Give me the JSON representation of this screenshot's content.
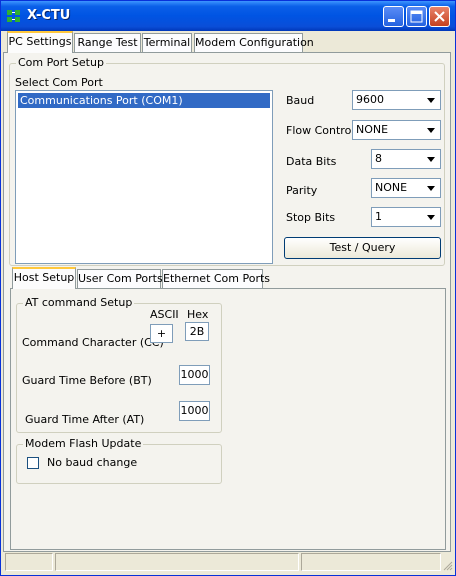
{
  "window": {
    "title": "X-CTU",
    "controls": [
      "minimize-icon",
      "maximize-icon",
      "close-icon"
    ]
  },
  "main_tabs": [
    {
      "label": "PC Settings",
      "active": true
    },
    {
      "label": "Range Test",
      "active": false
    },
    {
      "label": "Terminal",
      "active": false
    },
    {
      "label": "Modem Configuration",
      "active": false
    }
  ],
  "com_port_setup": {
    "group_title": "Com Port Setup",
    "select_label": "Select Com Port",
    "ports": [
      "Communications Port (COM1)"
    ],
    "selected_port": "Communications Port (COM1)",
    "baud": {
      "label": "Baud",
      "value": "9600"
    },
    "flow_control": {
      "label": "Flow Control",
      "value": "NONE"
    },
    "data_bits": {
      "label": "Data Bits",
      "value": "8"
    },
    "parity": {
      "label": "Parity",
      "value": "NONE"
    },
    "stop_bits": {
      "label": "Stop Bits",
      "value": "1"
    },
    "test_button": "Test  / Query"
  },
  "sub_tabs": [
    {
      "label": "Host Setup",
      "active": true
    },
    {
      "label": "User Com Ports",
      "active": false
    },
    {
      "label": "Ethernet Com Ports",
      "active": false
    }
  ],
  "at_command": {
    "group_title": "AT command Setup",
    "ascii_header": "ASCII",
    "hex_header": "Hex",
    "cc_label": "Command Character (CC)",
    "cc_ascii": "+",
    "cc_hex": "2B",
    "bt_label": "Guard Time Before (BT)",
    "bt_value": "1000",
    "at_label": "Guard Time After (AT)",
    "at_value": "1000"
  },
  "modem_flash": {
    "group_title": "Modem Flash Update",
    "checkbox_label": "No baud change",
    "checked": false
  },
  "colors": {
    "titlebar": "#0054e3",
    "selection": "#316ac5",
    "close_button": "#c6411f",
    "window_bg": "#ece9d8"
  }
}
